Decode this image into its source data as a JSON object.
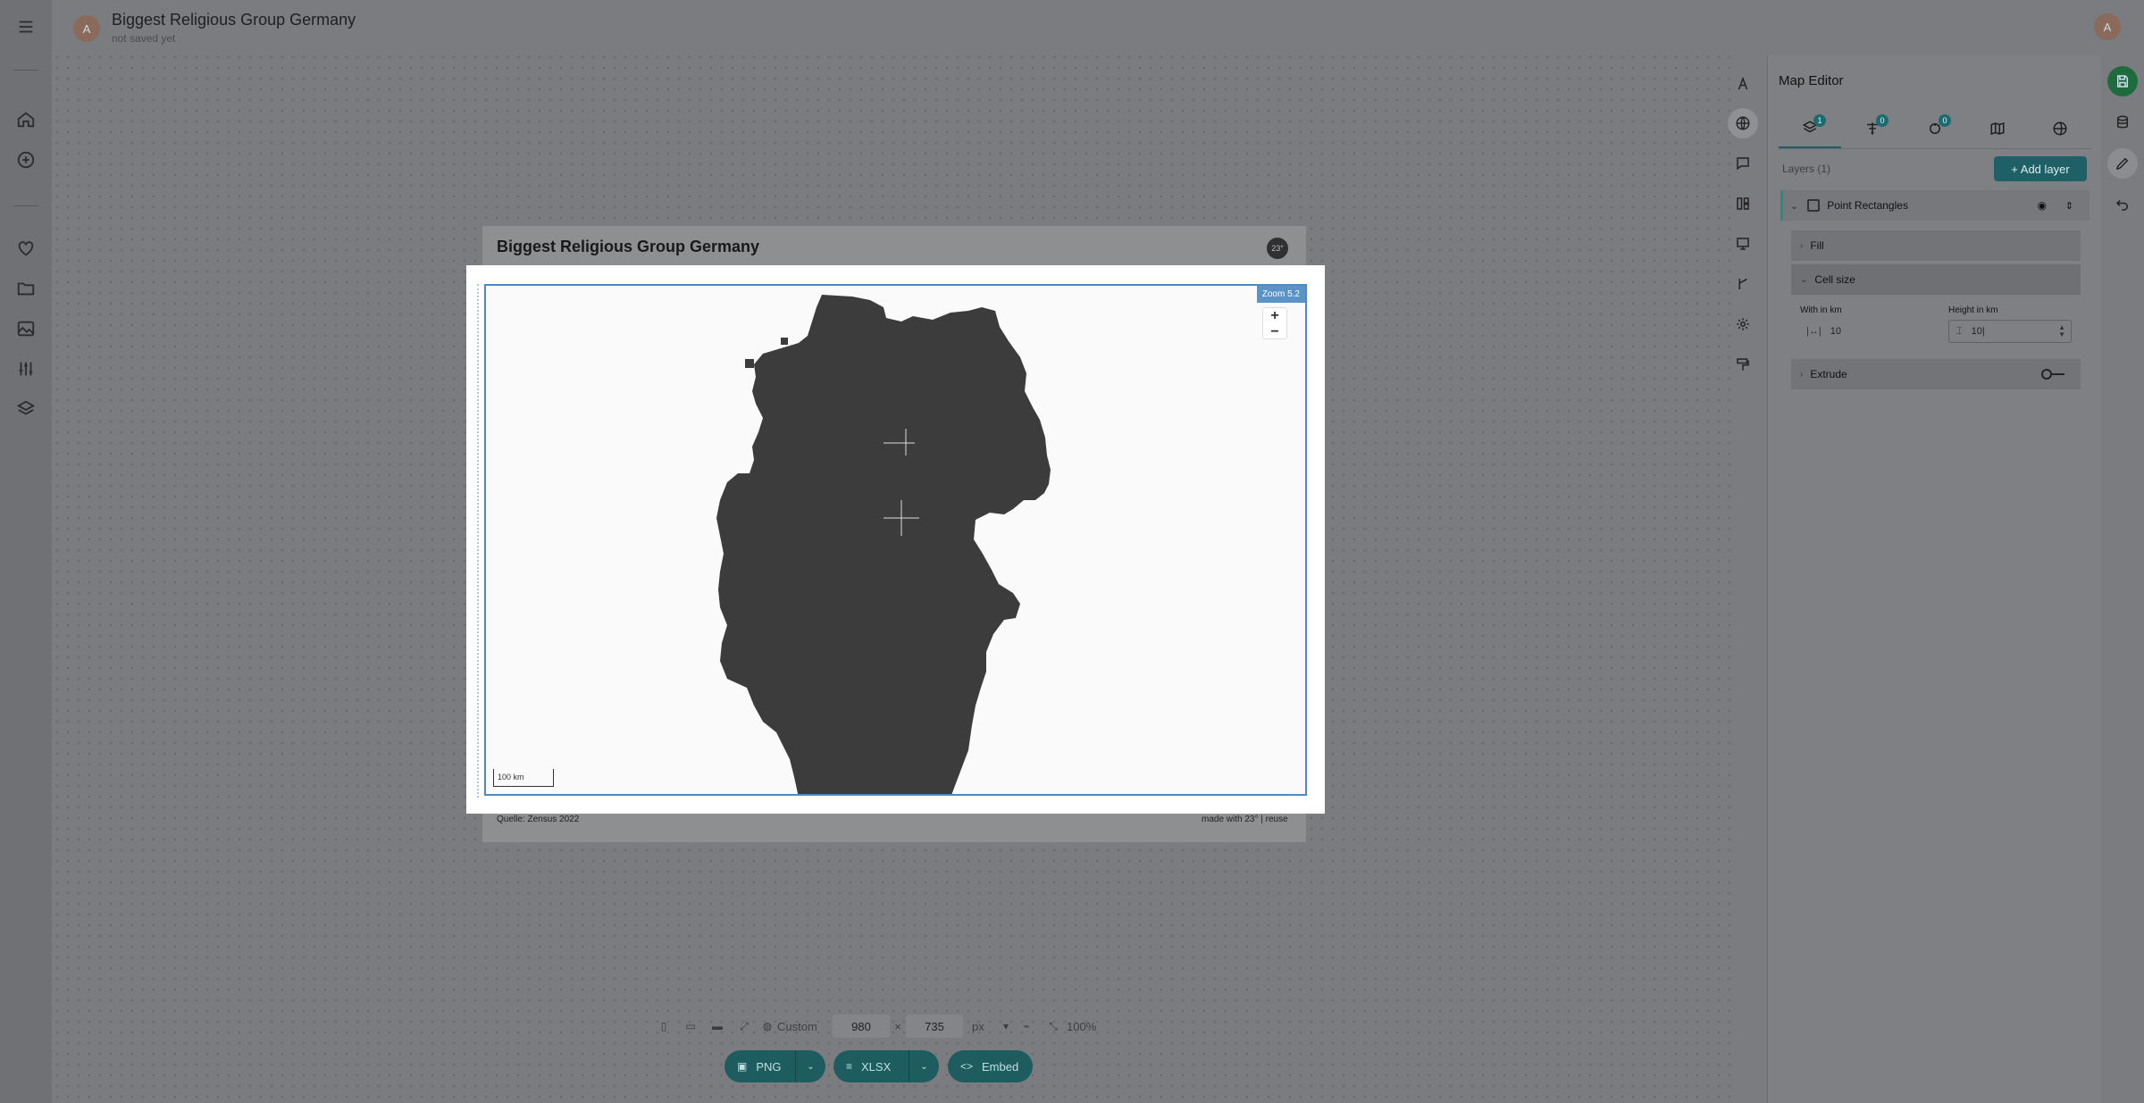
{
  "header": {
    "avatar_initial": "A",
    "title": "Biggest Religious Group Germany",
    "subtitle": "not saved yet",
    "user_initial": "A"
  },
  "card": {
    "title": "Biggest Religious Group Germany",
    "logo_text": "23°",
    "source": "Quelle: Zensus 2022",
    "made_with": "made with 23° | reuse"
  },
  "map": {
    "zoom_label": "Zoom 5.2",
    "zoom_in": "+",
    "zoom_out": "−",
    "scale_label": "100 km"
  },
  "editor": {
    "title": "Map Editor",
    "tabs": [
      {
        "icon": "layers-icon",
        "count": "1"
      },
      {
        "icon": "filter-icon",
        "count": "0"
      },
      {
        "icon": "link-icon",
        "count": "0"
      },
      {
        "icon": "map-icon",
        "count": ""
      },
      {
        "icon": "globe-icon",
        "count": ""
      }
    ],
    "layers_label": "Layers (1)",
    "add_layer": "+ Add layer",
    "layer_name": "Point Rectangles",
    "sections": {
      "fill": "Fill",
      "cell_size": "Cell size",
      "extrude": "Extrude"
    },
    "width_label": "With in km",
    "width_value": "10",
    "height_label": "Height in km",
    "height_value": "10|"
  },
  "size_bar": {
    "preset": "Custom",
    "width": "980",
    "times": "×",
    "height": "735",
    "unit": "px",
    "zoom": "100%"
  },
  "export": {
    "png": "PNG",
    "xlsx": "XLSX",
    "embed": "Embed"
  }
}
